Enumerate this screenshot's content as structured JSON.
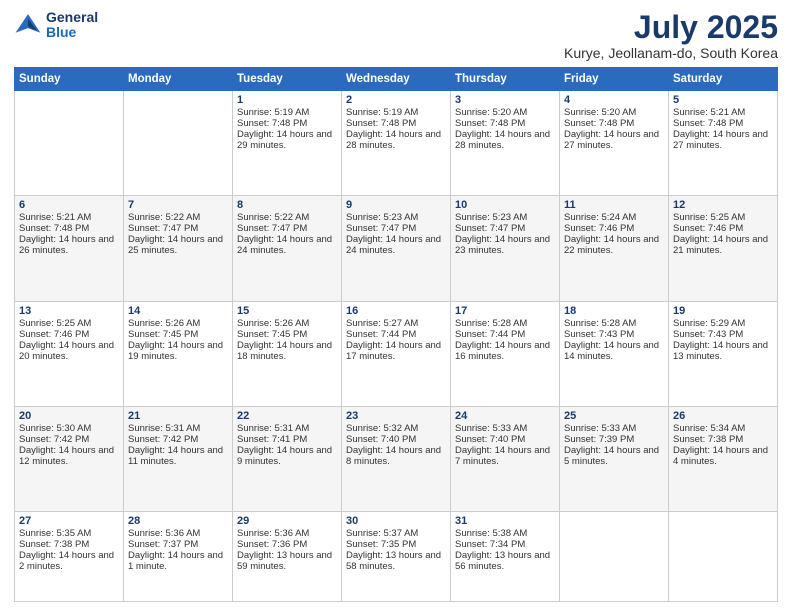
{
  "app": {
    "logo_line1": "General",
    "logo_line2": "Blue"
  },
  "title": "July 2025",
  "subtitle": "Kurye, Jeollanam-do, South Korea",
  "days": [
    "Sunday",
    "Monday",
    "Tuesday",
    "Wednesday",
    "Thursday",
    "Friday",
    "Saturday"
  ],
  "weeks": [
    [
      {
        "num": "",
        "info": ""
      },
      {
        "num": "",
        "info": ""
      },
      {
        "num": "1",
        "info": "Sunrise: 5:19 AM\nSunset: 7:48 PM\nDaylight: 14 hours and 29 minutes."
      },
      {
        "num": "2",
        "info": "Sunrise: 5:19 AM\nSunset: 7:48 PM\nDaylight: 14 hours and 28 minutes."
      },
      {
        "num": "3",
        "info": "Sunrise: 5:20 AM\nSunset: 7:48 PM\nDaylight: 14 hours and 28 minutes."
      },
      {
        "num": "4",
        "info": "Sunrise: 5:20 AM\nSunset: 7:48 PM\nDaylight: 14 hours and 27 minutes."
      },
      {
        "num": "5",
        "info": "Sunrise: 5:21 AM\nSunset: 7:48 PM\nDaylight: 14 hours and 27 minutes."
      }
    ],
    [
      {
        "num": "6",
        "info": "Sunrise: 5:21 AM\nSunset: 7:48 PM\nDaylight: 14 hours and 26 minutes."
      },
      {
        "num": "7",
        "info": "Sunrise: 5:22 AM\nSunset: 7:47 PM\nDaylight: 14 hours and 25 minutes."
      },
      {
        "num": "8",
        "info": "Sunrise: 5:22 AM\nSunset: 7:47 PM\nDaylight: 14 hours and 24 minutes."
      },
      {
        "num": "9",
        "info": "Sunrise: 5:23 AM\nSunset: 7:47 PM\nDaylight: 14 hours and 24 minutes."
      },
      {
        "num": "10",
        "info": "Sunrise: 5:23 AM\nSunset: 7:47 PM\nDaylight: 14 hours and 23 minutes."
      },
      {
        "num": "11",
        "info": "Sunrise: 5:24 AM\nSunset: 7:46 PM\nDaylight: 14 hours and 22 minutes."
      },
      {
        "num": "12",
        "info": "Sunrise: 5:25 AM\nSunset: 7:46 PM\nDaylight: 14 hours and 21 minutes."
      }
    ],
    [
      {
        "num": "13",
        "info": "Sunrise: 5:25 AM\nSunset: 7:46 PM\nDaylight: 14 hours and 20 minutes."
      },
      {
        "num": "14",
        "info": "Sunrise: 5:26 AM\nSunset: 7:45 PM\nDaylight: 14 hours and 19 minutes."
      },
      {
        "num": "15",
        "info": "Sunrise: 5:26 AM\nSunset: 7:45 PM\nDaylight: 14 hours and 18 minutes."
      },
      {
        "num": "16",
        "info": "Sunrise: 5:27 AM\nSunset: 7:44 PM\nDaylight: 14 hours and 17 minutes."
      },
      {
        "num": "17",
        "info": "Sunrise: 5:28 AM\nSunset: 7:44 PM\nDaylight: 14 hours and 16 minutes."
      },
      {
        "num": "18",
        "info": "Sunrise: 5:28 AM\nSunset: 7:43 PM\nDaylight: 14 hours and 14 minutes."
      },
      {
        "num": "19",
        "info": "Sunrise: 5:29 AM\nSunset: 7:43 PM\nDaylight: 14 hours and 13 minutes."
      }
    ],
    [
      {
        "num": "20",
        "info": "Sunrise: 5:30 AM\nSunset: 7:42 PM\nDaylight: 14 hours and 12 minutes."
      },
      {
        "num": "21",
        "info": "Sunrise: 5:31 AM\nSunset: 7:42 PM\nDaylight: 14 hours and 11 minutes."
      },
      {
        "num": "22",
        "info": "Sunrise: 5:31 AM\nSunset: 7:41 PM\nDaylight: 14 hours and 9 minutes."
      },
      {
        "num": "23",
        "info": "Sunrise: 5:32 AM\nSunset: 7:40 PM\nDaylight: 14 hours and 8 minutes."
      },
      {
        "num": "24",
        "info": "Sunrise: 5:33 AM\nSunset: 7:40 PM\nDaylight: 14 hours and 7 minutes."
      },
      {
        "num": "25",
        "info": "Sunrise: 5:33 AM\nSunset: 7:39 PM\nDaylight: 14 hours and 5 minutes."
      },
      {
        "num": "26",
        "info": "Sunrise: 5:34 AM\nSunset: 7:38 PM\nDaylight: 14 hours and 4 minutes."
      }
    ],
    [
      {
        "num": "27",
        "info": "Sunrise: 5:35 AM\nSunset: 7:38 PM\nDaylight: 14 hours and 2 minutes."
      },
      {
        "num": "28",
        "info": "Sunrise: 5:36 AM\nSunset: 7:37 PM\nDaylight: 14 hours and 1 minute."
      },
      {
        "num": "29",
        "info": "Sunrise: 5:36 AM\nSunset: 7:36 PM\nDaylight: 13 hours and 59 minutes."
      },
      {
        "num": "30",
        "info": "Sunrise: 5:37 AM\nSunset: 7:35 PM\nDaylight: 13 hours and 58 minutes."
      },
      {
        "num": "31",
        "info": "Sunrise: 5:38 AM\nSunset: 7:34 PM\nDaylight: 13 hours and 56 minutes."
      },
      {
        "num": "",
        "info": ""
      },
      {
        "num": "",
        "info": ""
      }
    ]
  ]
}
